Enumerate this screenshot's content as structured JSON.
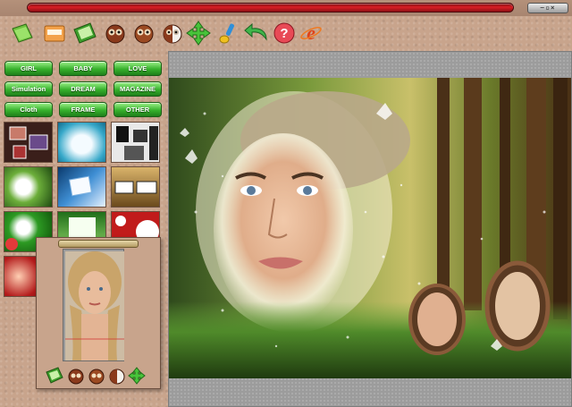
{
  "window": {
    "controls_label": "−▫×"
  },
  "toolbar": {
    "buttons": [
      {
        "name": "open-folder-button",
        "icon": "green-folder-icon"
      },
      {
        "name": "save-button",
        "icon": "folder-save-icon"
      },
      {
        "name": "open-image-button",
        "icon": "green-image-icon"
      },
      {
        "name": "owl-tool-1-button",
        "icon": "owl-icon"
      },
      {
        "name": "owl-tool-2-button",
        "icon": "owl-icon"
      },
      {
        "name": "owl-tool-3-button",
        "icon": "owl-half-icon"
      },
      {
        "name": "move-button",
        "icon": "move-arrows-icon"
      },
      {
        "name": "brush-button",
        "icon": "paint-brush-icon"
      },
      {
        "name": "undo-button",
        "icon": "undo-arrow-icon"
      },
      {
        "name": "help-button",
        "icon": "question-mark-icon"
      },
      {
        "name": "browser-button",
        "icon": "internet-explorer-icon"
      }
    ]
  },
  "categories": [
    [
      "GIRL",
      "BABY",
      "LOVE"
    ],
    [
      "Simulation",
      "DREAM",
      "MAGAZINE"
    ],
    [
      "Cloth",
      "FRAME",
      "OTHER"
    ]
  ],
  "thumbnails": [
    "frame-thumb-1",
    "frame-thumb-2",
    "frame-thumb-3",
    "frame-thumb-4",
    "frame-thumb-5",
    "frame-thumb-6",
    "frame-thumb-7",
    "frame-thumb-8",
    "frame-thumb-9",
    "frame-thumb-10",
    "frame-thumb-11",
    "frame-thumb-12"
  ],
  "preview": {
    "buttons": [
      "green-image-icon",
      "owl-icon",
      "owl-icon",
      "owl-half-icon",
      "move-arrows-icon"
    ]
  },
  "colors": {
    "accent_green": "#37b12c",
    "title_red": "#d91e24",
    "background": "#c8a48c"
  }
}
